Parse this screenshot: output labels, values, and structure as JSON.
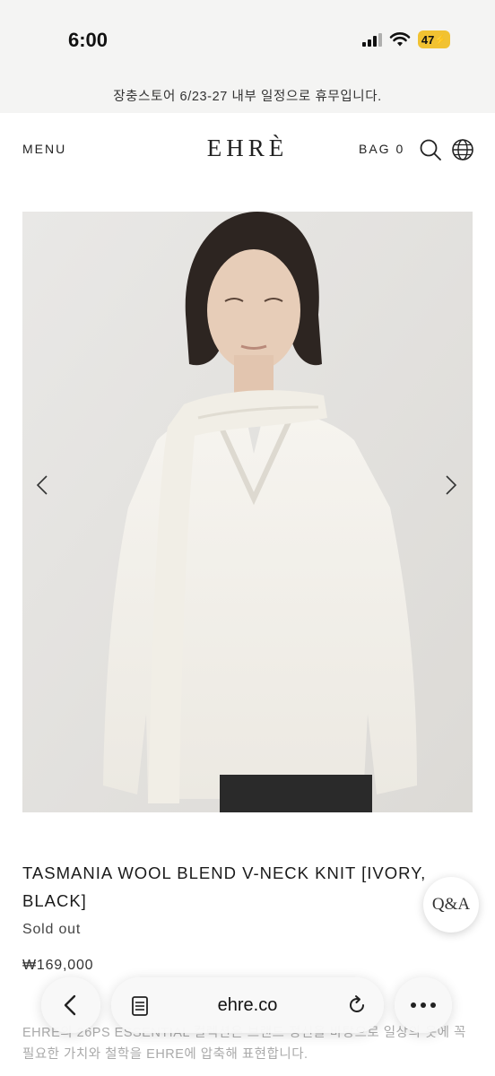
{
  "status_bar": {
    "time": "6:00",
    "battery": "47",
    "icons": [
      "cellular-signal-icon",
      "wifi-icon",
      "battery-charging-icon"
    ],
    "battery_color": "#f1c232"
  },
  "notice": {
    "text": "장충스토어 6/23-27 내부 일정으로 휴무입니다."
  },
  "header": {
    "menu_label": "MENU",
    "logo": "EHRÈ",
    "bag_label": "BAG 0",
    "icons": [
      "search-icon",
      "globe-icon"
    ]
  },
  "product": {
    "image_alt": "Model wearing ivory wool V-neck knit with scarf",
    "title": "TASMANIA WOOL BLEND V-NECK KNIT [IVORY, BLACK]",
    "status": "Sold out",
    "price": "₩169,000",
    "description": "EHRE의 26PS ESSENTIAL 컬렉션은 브랜드 정신을 바탕으로 일상의 옷에 꼭 필요한 가치와 철학을 EHRE에 압축해 표현합니다."
  },
  "qa_button": {
    "label": "Q&A"
  },
  "browser": {
    "url": "ehre.co",
    "icons": [
      "back-icon",
      "reader-icon",
      "reload-icon",
      "more-icon"
    ]
  }
}
